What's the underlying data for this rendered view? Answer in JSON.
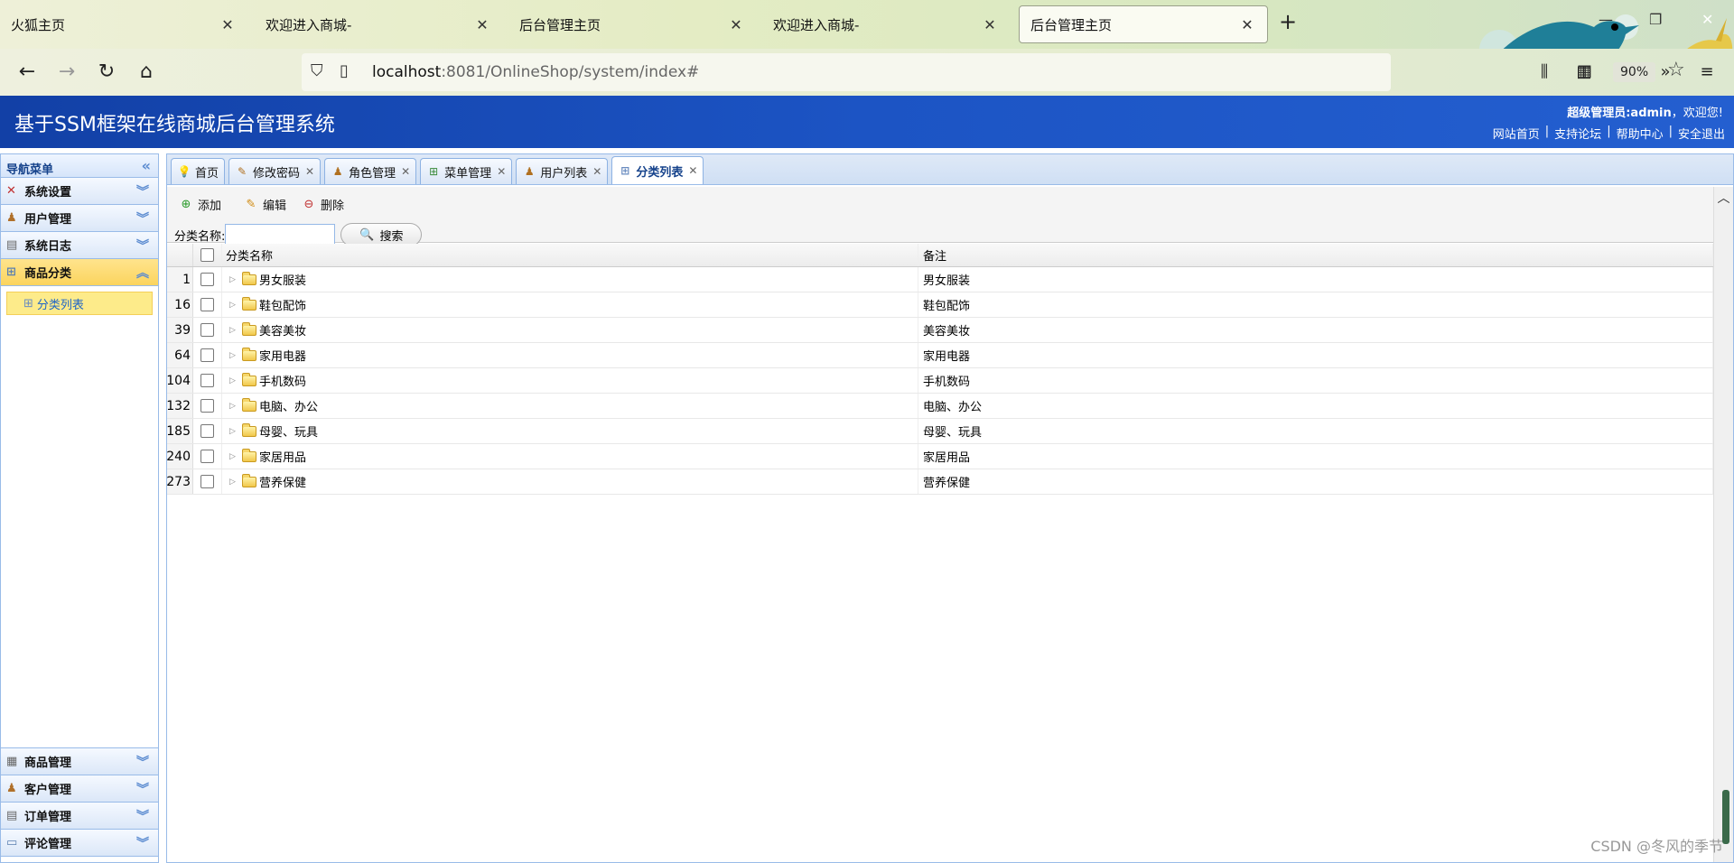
{
  "browser": {
    "tabs": [
      {
        "title": "火狐主页"
      },
      {
        "title": "欢迎进入商城-"
      },
      {
        "title": "后台管理主页"
      },
      {
        "title": "欢迎进入商城-"
      },
      {
        "title": "后台管理主页"
      }
    ],
    "url_host": "localhost",
    "url_rest": ":8081/OnlineShop/system/index#",
    "zoom": "90%"
  },
  "header": {
    "title": "基于SSM框架在线商城后台管理系统",
    "welcome_user": "超级管理员:admin",
    "welcome_suffix": "，欢迎您!",
    "links": [
      "网站首页",
      "支持论坛",
      "帮助中心",
      "安全退出"
    ]
  },
  "sidebar": {
    "title": "导航菜单",
    "sections_top": [
      {
        "label": "系统设置",
        "icon": "tools-icon"
      },
      {
        "label": "用户管理",
        "icon": "users-icon"
      },
      {
        "label": "系统日志",
        "icon": "log-icon"
      },
      {
        "label": "商品分类",
        "icon": "category-icon"
      }
    ],
    "active_leaf": "分类列表",
    "sections_bottom": [
      {
        "label": "商品管理",
        "icon": "goods-icon"
      },
      {
        "label": "客户管理",
        "icon": "customer-icon"
      },
      {
        "label": "订单管理",
        "icon": "order-icon"
      },
      {
        "label": "评论管理",
        "icon": "comment-icon"
      }
    ]
  },
  "panel_tabs": [
    {
      "label": "首页"
    },
    {
      "label": "修改密码"
    },
    {
      "label": "角色管理"
    },
    {
      "label": "菜单管理"
    },
    {
      "label": "用户列表"
    },
    {
      "label": "分类列表"
    }
  ],
  "toolbar": {
    "add": "添加",
    "edit": "编辑",
    "delete": "删除",
    "search_label": "分类名称:",
    "search_value": "",
    "search_button": "搜索"
  },
  "grid": {
    "columns": [
      "分类名称",
      "备注"
    ],
    "rows": [
      {
        "id": "1",
        "name": "男女服装",
        "note": "男女服装"
      },
      {
        "id": "16",
        "name": "鞋包配饰",
        "note": "鞋包配饰"
      },
      {
        "id": "39",
        "name": "美容美妆",
        "note": "美容美妆"
      },
      {
        "id": "64",
        "name": "家用电器",
        "note": "家用电器"
      },
      {
        "id": "104",
        "name": "手机数码",
        "note": "手机数码"
      },
      {
        "id": "132",
        "name": "电脑、办公",
        "note": "电脑、办公"
      },
      {
        "id": "185",
        "name": "母婴、玩具",
        "note": "母婴、玩具"
      },
      {
        "id": "240",
        "name": "家居用品",
        "note": "家居用品"
      },
      {
        "id": "273",
        "name": "营养保健",
        "note": "营养保健"
      }
    ]
  },
  "watermark": "CSDN @冬风的季节",
  "colors": {
    "header_blue": "#1c54c4",
    "selected_yellow": "#fbd45e",
    "border_blue": "#99bbe8"
  }
}
